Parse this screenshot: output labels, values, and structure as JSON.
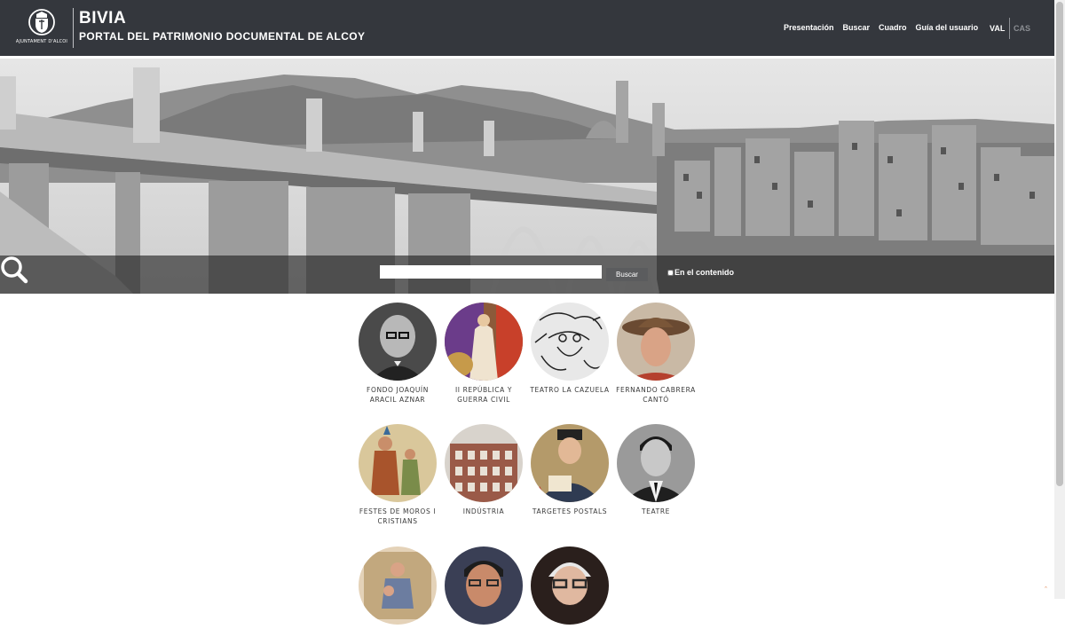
{
  "header": {
    "logo_text": "AJUNTAMENT D'ALCOI",
    "title": "BIVIA",
    "subtitle": "PORTAL DEL PATRIMONIO DOCUMENTAL DE ALCOY",
    "nav": [
      "Presentación",
      "Buscar",
      "Cuadro",
      "Guía del usuario"
    ],
    "lang_active": "VAL",
    "lang_other": "CAS"
  },
  "search": {
    "value": "",
    "placeholder": "",
    "button_label": "Buscar",
    "checkbox_label": "En el contenido",
    "checkbox_checked": false
  },
  "collections": [
    {
      "label": "FONDO JOAQUÍN ARACIL AZNAR",
      "icon": "portrait-man-glasses"
    },
    {
      "label": "II REPÚBLICA Y GUERRA CIVIL",
      "icon": "republic-allegory"
    },
    {
      "label": "TEATRO LA CAZUELA",
      "icon": "theatre-drawing"
    },
    {
      "label": "FERNANDO CABRERA CANTÓ",
      "icon": "portrait-man-hat"
    },
    {
      "label": "FESTES DE MOROS I CRISTIANS",
      "icon": "festival-costume"
    },
    {
      "label": "INDÚSTRIA",
      "icon": "industrial-building"
    },
    {
      "label": "TARGETES POSTALS",
      "icon": "postcard-soldier"
    },
    {
      "label": "TEATRE",
      "icon": "portrait-man-suit"
    },
    {
      "label": "",
      "icon": "painting-figure"
    },
    {
      "label": "",
      "icon": "portrait-man-glasses-2"
    },
    {
      "label": "",
      "icon": "portrait-old-man-beard"
    }
  ],
  "colors": {
    "header_bg": "#34373d",
    "accent": "#e28b5a"
  }
}
